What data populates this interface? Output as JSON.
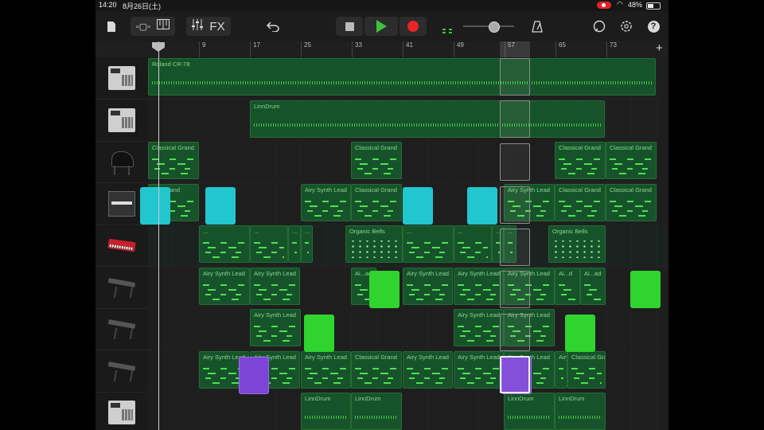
{
  "status": {
    "time": "14:20",
    "date": "8月26日(土)",
    "battery": "48%"
  },
  "toolbar": {
    "fx_label": "FX",
    "icons": [
      "my-songs-icon",
      "browser-icon",
      "tracks-view-icon",
      "mixer-icon",
      "undo-icon",
      "stop-icon",
      "play-icon",
      "record-icon",
      "volume-slider",
      "metronome-icon",
      "loop-browser-icon",
      "settings-icon",
      "help-icon"
    ],
    "volume_level": 0.6,
    "help_label": "?"
  },
  "ruler": {
    "bars": [
      "9",
      "17",
      "25",
      "33",
      "41",
      "49",
      "57",
      "65",
      "73"
    ]
  },
  "add_track_label": "+",
  "tracks": [
    {
      "instrument": "drum-machine",
      "regions": [
        {
          "name": "Roland CR-78",
          "type": "drum"
        }
      ]
    },
    {
      "instrument": "drum-machine",
      "regions": [
        {
          "name": "LinnDrum",
          "type": "drum"
        }
      ]
    },
    {
      "instrument": "grand-piano",
      "regions": [
        {
          "name": "Classical Grand"
        },
        {
          "name": "Classical Grand"
        },
        {
          "name": "Classical Grand"
        },
        {
          "name": "Classical Grand"
        }
      ]
    },
    {
      "instrument": "upright-piano",
      "regions": [
        {
          "name": "...al Grand"
        },
        {
          "name": "Airy Synth Lead"
        },
        {
          "name": "Classical Grand"
        },
        {
          "name": "Airy Synth Lead"
        },
        {
          "name": "Classical Grand"
        },
        {
          "name": "Classical Grand"
        }
      ]
    },
    {
      "instrument": "synth-red",
      "regions": [
        {
          "name": "..."
        },
        {
          "name": "..."
        },
        {
          "name": "..."
        },
        {
          "name": "..."
        },
        {
          "name": "Organic Bells",
          "type": "bells"
        },
        {
          "name": "..."
        },
        {
          "name": "..."
        },
        {
          "name": "..."
        },
        {
          "name": "..."
        },
        {
          "name": "Organic Bells",
          "type": "bells"
        }
      ]
    },
    {
      "instrument": "synth-stand",
      "regions": [
        {
          "name": "Airy Synth Lead"
        },
        {
          "name": "Airy Synth Lead"
        },
        {
          "name": "Ai...ad"
        },
        {
          "name": "Airy Synth Lead"
        },
        {
          "name": "Airy Synth Lead"
        },
        {
          "name": "Airy Synth Lead"
        },
        {
          "name": "Ai...d"
        },
        {
          "name": "Ai...ad"
        }
      ]
    },
    {
      "instrument": "synth-stand",
      "regions": [
        {
          "name": "Airy Synth Lead"
        },
        {
          "name": "Airy Synth Lead"
        },
        {
          "name": "Airy Synth Lead"
        }
      ]
    },
    {
      "instrument": "synth-stand",
      "regions": [
        {
          "name": "Airy Synth Lead"
        },
        {
          "name": "Airy Synth Lead"
        },
        {
          "name": "Airy Synth Lead"
        },
        {
          "name": "Classical Grand"
        },
        {
          "name": "Airy Synth Lead"
        },
        {
          "name": "Airy Synth Lead"
        },
        {
          "name": "Airy Synth Lead"
        },
        {
          "name": "Airy Synth Lead"
        },
        {
          "name": "Classical Grand"
        }
      ]
    },
    {
      "instrument": "drum-machine",
      "regions": [
        {
          "name": "LinnDrum",
          "type": "drum"
        },
        {
          "name": "LinnDrum",
          "type": "drum"
        },
        {
          "name": "LinnDrum",
          "type": "drum"
        },
        {
          "name": "LinnDrum",
          "type": "drum"
        }
      ]
    }
  ],
  "colors": {
    "region": "#17532a",
    "notes": "#4ee052",
    "cyan": "#22c6cf",
    "green": "#2fd42f",
    "purple": "#7d44d7",
    "record": "#e8252a"
  }
}
